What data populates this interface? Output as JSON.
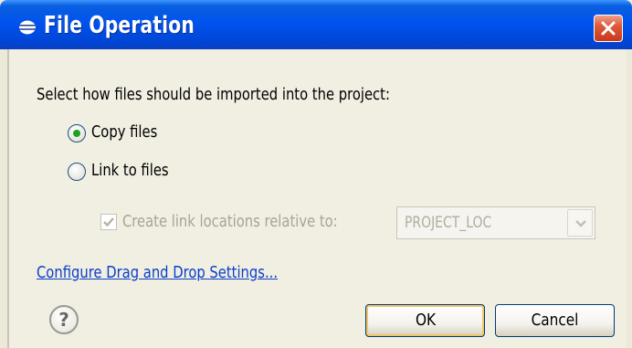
{
  "window": {
    "title": "File Operation",
    "close_icon": "close-icon",
    "title_icon": "eclipse-icon"
  },
  "prompt": "Select how files should be imported into the project:",
  "options": {
    "copy_files": {
      "label": "Copy files",
      "selected": true
    },
    "link_to_files": {
      "label": "Link to files",
      "selected": false
    }
  },
  "relative": {
    "label": "Create link locations relative to:",
    "checked": true,
    "enabled": false,
    "combo_value": "PROJECT_LOC"
  },
  "link": {
    "label": "Configure Drag and Drop Settings..."
  },
  "help": {
    "glyph": "?"
  },
  "buttons": {
    "ok": "OK",
    "cancel": "Cancel"
  },
  "colors": {
    "titlebar": "#0053ee",
    "close": "#e05a3a",
    "link": "#0b3ec9",
    "radio_dot": "#21a121",
    "disabled_text": "#a6a498"
  }
}
